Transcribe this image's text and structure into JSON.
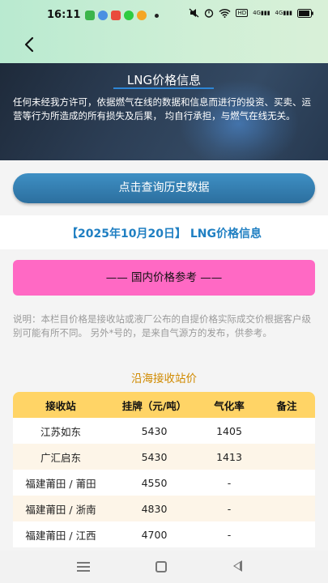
{
  "status_bar": {
    "time": "16:11",
    "notification_icons": [
      "message-icon",
      "browser-icon",
      "video-icon",
      "chat-icon",
      "social-icon",
      "dot-icon"
    ],
    "system_icons": [
      "mute-icon",
      "alarm-icon",
      "wifi-icon",
      "hd-icon",
      "signal-icon",
      "signal-icon",
      "battery-icon"
    ],
    "hd_text": "HD",
    "signal1_text": "4G",
    "signal2_text": "4G"
  },
  "header": {
    "back_icon": "back-chevron-icon"
  },
  "hero": {
    "title": "LNG价格信息",
    "disclaimer": "任何未经我方许可，依据燃气在线的数据和信息而进行的投资、买卖、运营等行为所造成的所有损失及后果， 均自行承担，与燃气在线无关。"
  },
  "history_button": {
    "label": "点击查询历史数据"
  },
  "date_title": "【2025年10月20日】 LNG价格信息",
  "domestic_bar": {
    "label": "——   国内价格参考  ——"
  },
  "note": "说明：本栏目价格是接收站或液厂公布的自提价格实际成交价根据客户级别可能有所不同。 另外*号的，是来自气源方的发布，供参考。",
  "coastal_section": {
    "title": "沿海接收站价",
    "columns": [
      "接收站",
      "挂牌（元/吨）",
      "气化率",
      "备注"
    ],
    "rows": [
      {
        "station": "江苏如东",
        "price": "5430",
        "gasification": "1405",
        "remark": ""
      },
      {
        "station": "广汇启东",
        "price": "5430",
        "gasification": "1413",
        "remark": ""
      },
      {
        "station": "福建莆田 / 莆田",
        "price": "4550",
        "gasification": "-",
        "remark": ""
      },
      {
        "station": "福建莆田 / 浙南",
        "price": "4830",
        "gasification": "-",
        "remark": ""
      },
      {
        "station": "福建莆田 / 江西",
        "price": "4700",
        "gasification": "-",
        "remark": ""
      }
    ]
  },
  "nav_bar": {
    "icons": [
      "menu-icon",
      "home-icon",
      "back-icon"
    ]
  },
  "colors": {
    "accent_blue": "#1f7fc2",
    "button_blue": "#3e8fc4",
    "pink_bar": "#ff69c4",
    "table_header": "#ffd466",
    "section_title": "#d08a00"
  }
}
